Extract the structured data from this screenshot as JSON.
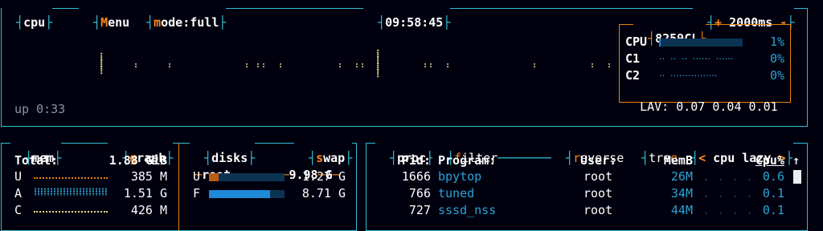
{
  "cpu_box": {
    "name": "cpu",
    "menu_first": "M",
    "menu_rest": "enu",
    "mode_first": "m",
    "mode_rest": "ode:full",
    "clock": "09:58:45",
    "interval_minus": "-",
    "interval_plus": "+",
    "interval": "2000ms",
    "uptime": "up 0:33",
    "cpu_name": "8259CL",
    "cores": [
      {
        "label": "CPU",
        "percent": "1%",
        "fill": 0.01
      },
      {
        "label": "C1",
        "percent": "0%",
        "fill": 0.0
      },
      {
        "label": "C2",
        "percent": "0%",
        "fill": 0.0
      }
    ],
    "lav_label": "LAV:",
    "lav_values": "0.07 0.04 0.01"
  },
  "mem_box": {
    "name": "mem",
    "graph_first": "g",
    "graph_rest": "raph",
    "total_label": "Total:",
    "total_value": "1.88 GiB",
    "rows": [
      {
        "label": "U",
        "value": "385 M"
      },
      {
        "label": "A",
        "value": "1.51 G"
      },
      {
        "label": "C",
        "value": "426 M"
      }
    ]
  },
  "disks_box": {
    "name": "disks",
    "swap_first": "s",
    "swap_rest": "wap",
    "mount": "root",
    "mount_total": "9.98",
    "mount_unit": "G",
    "rows": [
      {
        "label": "U",
        "value": "1.27 G",
        "fill": 0.13
      },
      {
        "label": "F",
        "value": "8.71 G",
        "fill": 0.87
      }
    ]
  },
  "proc_box": {
    "name": "proc",
    "filter_first": "f",
    "filter_rest": "ilter",
    "reverse_first": "r",
    "reverse_rest": "everse",
    "tree_start": "tre",
    "tree_last": "e",
    "sort_prev": "<",
    "sort_label": "cpu lazy",
    "sort_next": ">",
    "up_arrow": "↑",
    "headers": {
      "pid": "Pid:",
      "program": "Program:",
      "user": "User:",
      "memb": "MemB",
      "cpu": "Cpu%"
    },
    "rows": [
      {
        "pid": "1666",
        "program": "bpytop",
        "user": "root",
        "memb": "26M",
        "cpu": "0.6"
      },
      {
        "pid": "766",
        "program": "tuned",
        "user": "root",
        "memb": "34M",
        "cpu": "0.1"
      },
      {
        "pid": "727",
        "program": "sssd_nss",
        "user": "root",
        "memb": "44M",
        "cpu": "0.1"
      }
    ]
  },
  "colors": {
    "border": "#31c0d6",
    "accent": "#ff8a1c",
    "bar": "#1e8ad8",
    "background": "#00000f"
  }
}
